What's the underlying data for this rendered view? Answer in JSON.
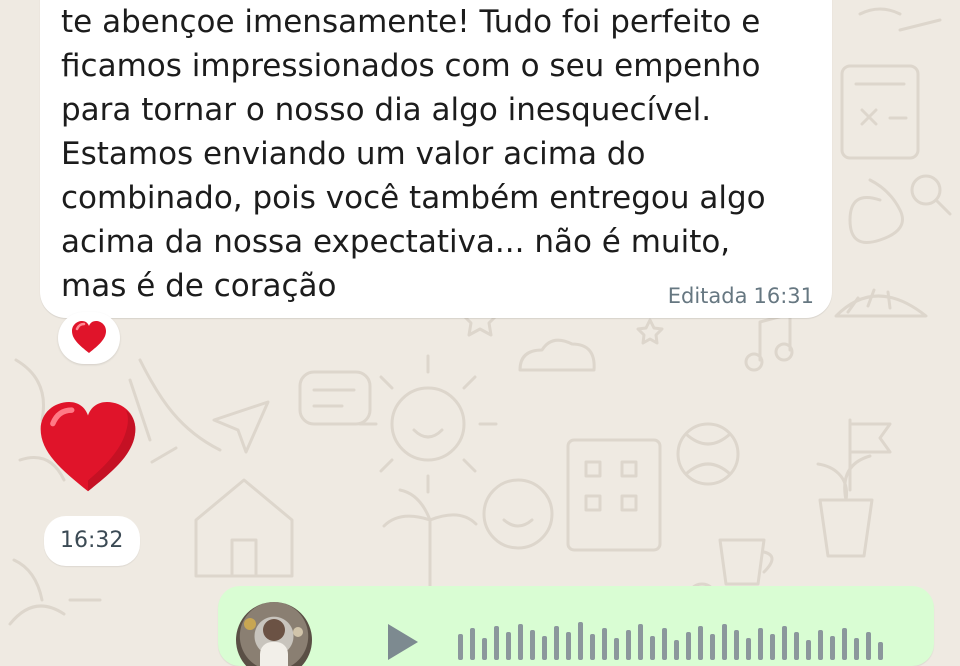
{
  "message": {
    "lines": [
      "te abençoe imensamente! Tudo foi perfeito e",
      "ficamos impressionados com o seu empenho",
      "para tornar o nosso dia algo inesquecível.",
      "Estamos enviando um valor acima do",
      "combinado, pois você também entregou algo",
      "acima da nossa expectativa... não é muito,",
      "mas é de coração"
    ],
    "edited_label": "Editada",
    "time": "16:31",
    "reaction": "heart-emoji"
  },
  "heart_message": {
    "emoji": "heart-emoji",
    "time": "16:32"
  },
  "voice_message": {
    "avatar": "avatar-photo",
    "play_icon": "play-icon"
  },
  "colors": {
    "chat_background": "#efeae2",
    "incoming_bubble": "#ffffff",
    "outgoing_bubble": "#d9fdd3",
    "heart": "#e0142a",
    "meta_text": "#667781"
  }
}
